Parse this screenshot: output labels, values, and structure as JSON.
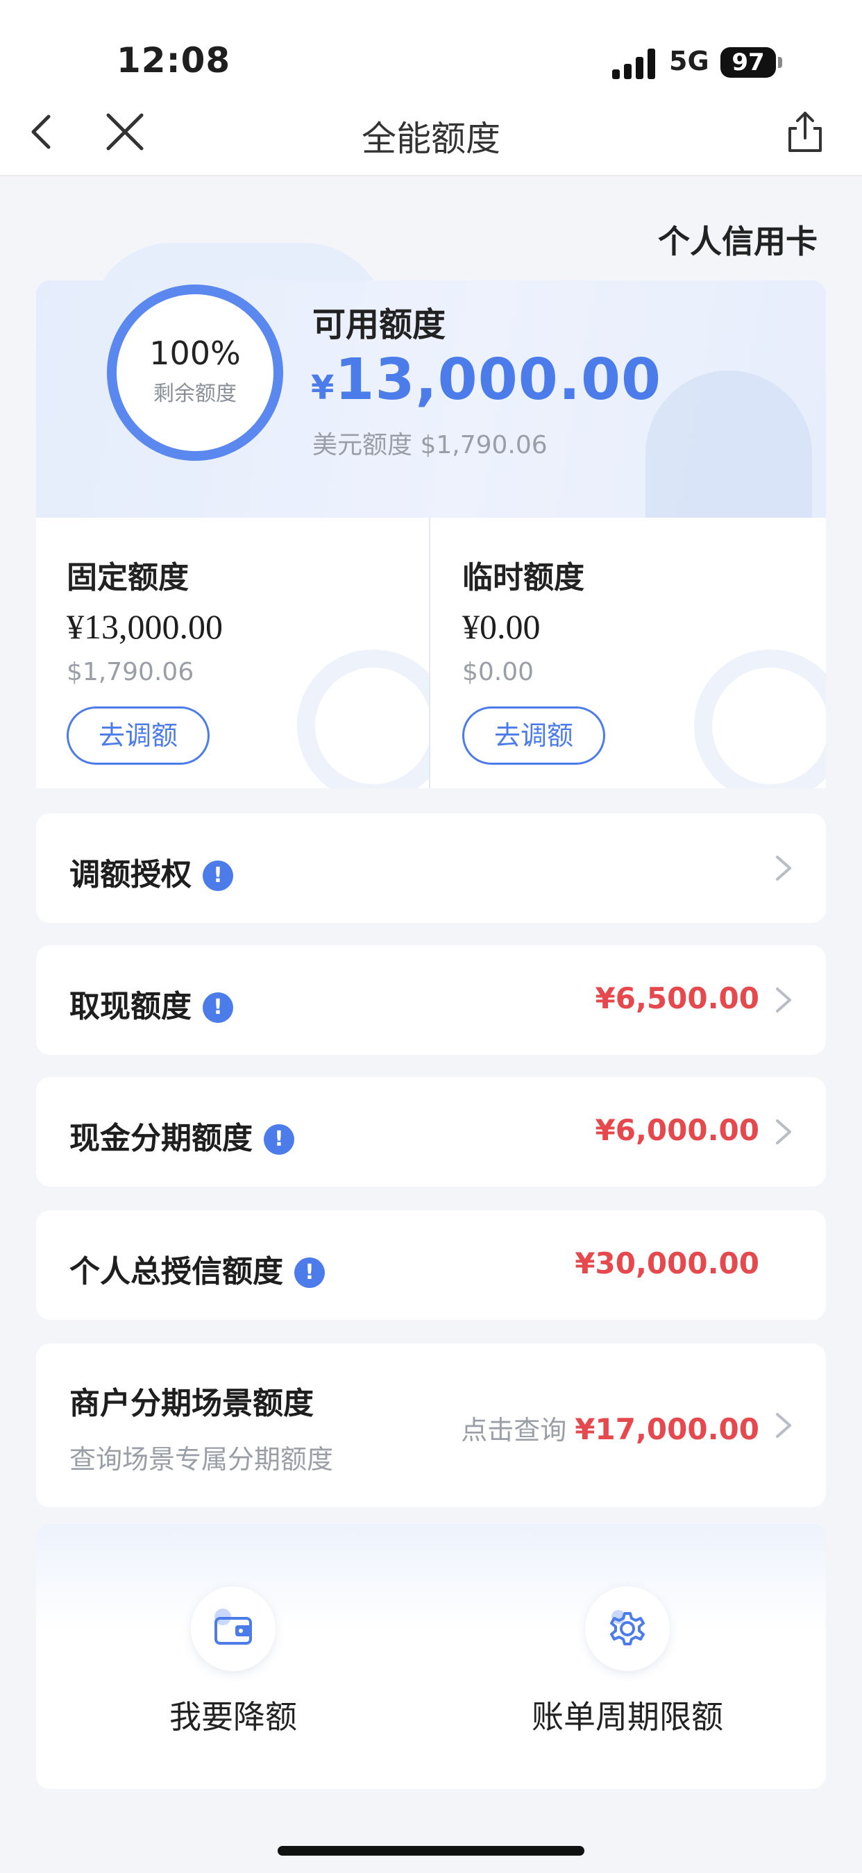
{
  "status_bar": {
    "time": "12:08",
    "network": "5G",
    "battery": "97"
  },
  "nav": {
    "title": "全能额度"
  },
  "card_type": "个人信用卡",
  "ring": {
    "percent_text": "100%",
    "percent_value": 100,
    "caption": "剩余额度"
  },
  "available": {
    "label": "可用额度",
    "currency": "¥",
    "amount": "13,000.00",
    "usd": "美元额度 $1,790.06"
  },
  "fixed": {
    "title": "固定额度",
    "cny": "¥13,000.00",
    "usd": "$1,790.06",
    "button": "去调额"
  },
  "temporary": {
    "title": "临时额度",
    "cny": "¥0.00",
    "usd": "$0.00",
    "button": "去调额"
  },
  "rows": [
    {
      "label": "调额授权",
      "value": ""
    },
    {
      "label": "取现额度",
      "value": "¥6,500.00"
    },
    {
      "label": "现金分期额度",
      "value": "¥6,000.00"
    },
    {
      "label": "个人总授信额度",
      "value": "¥30,000.00"
    }
  ],
  "merchant": {
    "label": "商户分期场景额度",
    "sub": "查询场景专属分期额度",
    "hint": "点击查询",
    "value": "¥17,000.00"
  },
  "actions": [
    {
      "label": "我要降额",
      "icon": "wallet-icon"
    },
    {
      "label": "账单周期限额",
      "icon": "gear-icon"
    }
  ],
  "colors": {
    "accent": "#4b7cea",
    "amount_red": "#e5484d"
  }
}
